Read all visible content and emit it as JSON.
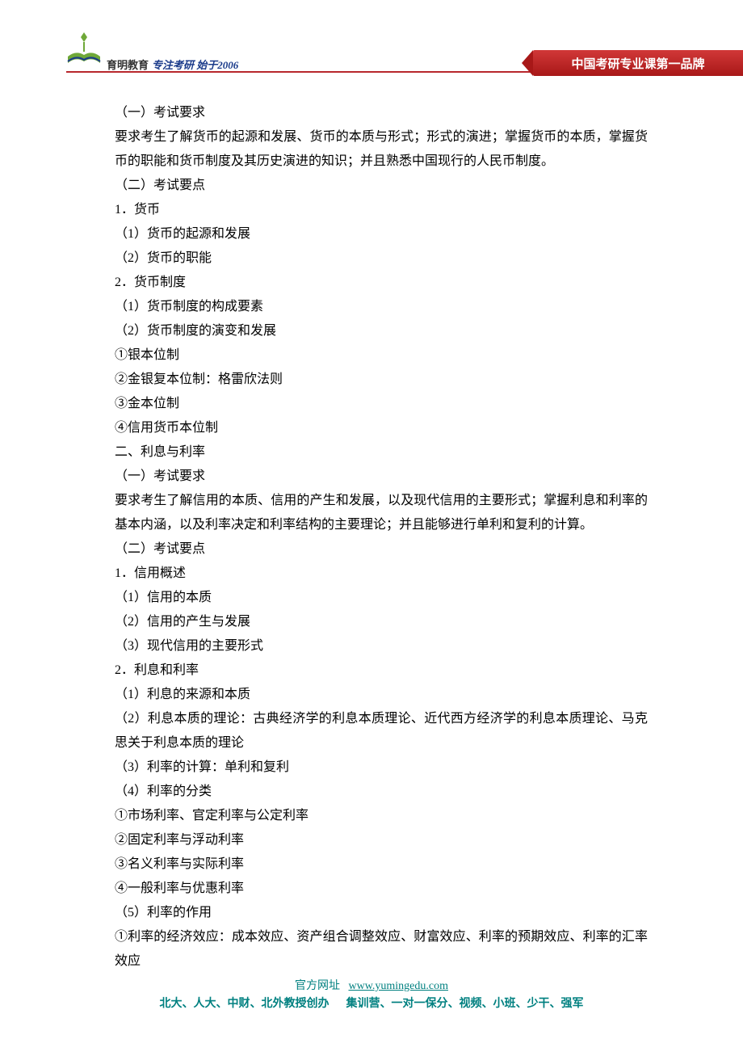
{
  "header": {
    "logo_text": "育明教育",
    "tagline": "专注考研 始于2006",
    "banner": "中国考研专业课第一品牌"
  },
  "content": {
    "lines": [
      "（一）考试要求",
      "要求考生了解货币的起源和发展、货币的本质与形式；形式的演进；掌握货币的本质，掌握货币的职能和货币制度及其历史演进的知识；并且熟悉中国现行的人民币制度。",
      "（二）考试要点",
      "1．货币",
      "（1）货币的起源和发展",
      "（2）货币的职能",
      "2．货币制度",
      "（1）货币制度的构成要素",
      "（2）货币制度的演变和发展",
      "①银本位制",
      "②金银复本位制：格雷欣法则",
      "③金本位制",
      "④信用货币本位制",
      "二、利息与利率",
      "（一）考试要求",
      "要求考生了解信用的本质、信用的产生和发展，以及现代信用的主要形式；掌握利息和利率的基本内涵，以及利率决定和利率结构的主要理论；并且能够进行单利和复利的计算。",
      "（二）考试要点",
      "1．信用概述",
      "（1）信用的本质",
      "（2）信用的产生与发展",
      "（3）现代信用的主要形式",
      "2．利息和利率",
      "（1）利息的来源和本质",
      "（2）利息本质的理论：古典经济学的利息本质理论、近代西方经济学的利息本质理论、马克思关于利息本质的理论",
      "（3）利率的计算：单利和复利",
      "（4）利率的分类",
      "①市场利率、官定利率与公定利率",
      "②固定利率与浮动利率",
      "③名义利率与实际利率",
      "④一般利率与优惠利率",
      "（5）利率的作用",
      "①利率的经济效应：成本效应、资产组合调整效应、财富效应、利率的预期效应、利率的汇率效应"
    ]
  },
  "footer": {
    "label": "官方网址",
    "url": "www.yumingedu.com",
    "line2_left": "北大、人大、中财、北外教授创办",
    "line2_right": "集训营、一对一保分、视频、小班、少干、强军"
  }
}
